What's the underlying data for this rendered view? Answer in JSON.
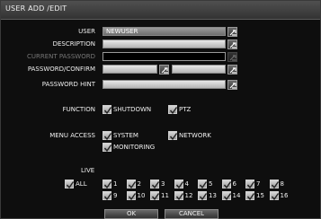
{
  "window": {
    "title": "USER ADD /EDIT"
  },
  "form": {
    "user_label": "USER",
    "user_value": "NEWUSER",
    "description_label": "DESCRIPTION",
    "current_password_label": "CURRENT PASSWORD",
    "password_confirm_label": "PASSWORD/CONFIRM",
    "password_hint_label": "PASSWORD HINT"
  },
  "function": {
    "label": "FUNCTION",
    "options": [
      {
        "label": "SHUTDOWN",
        "checked": true
      },
      {
        "label": "PTZ",
        "checked": true
      }
    ]
  },
  "menu_access": {
    "label": "MENU ACCESS",
    "options": [
      {
        "label": "SYSTEM",
        "checked": true
      },
      {
        "label": "NETWORK",
        "checked": true
      },
      {
        "label": "MONITORING",
        "checked": true
      }
    ]
  },
  "live": {
    "label": "LIVE",
    "all_label": "ALL",
    "channels": [
      "1",
      "2",
      "3",
      "4",
      "5",
      "6",
      "7",
      "8",
      "9",
      "10",
      "11",
      "12",
      "13",
      "14",
      "15",
      "16"
    ]
  },
  "buttons": {
    "ok": "OK",
    "cancel": "CANCEL"
  },
  "icons": {
    "keyboard": "keyboard-icon",
    "check": "checkmark-icon"
  }
}
